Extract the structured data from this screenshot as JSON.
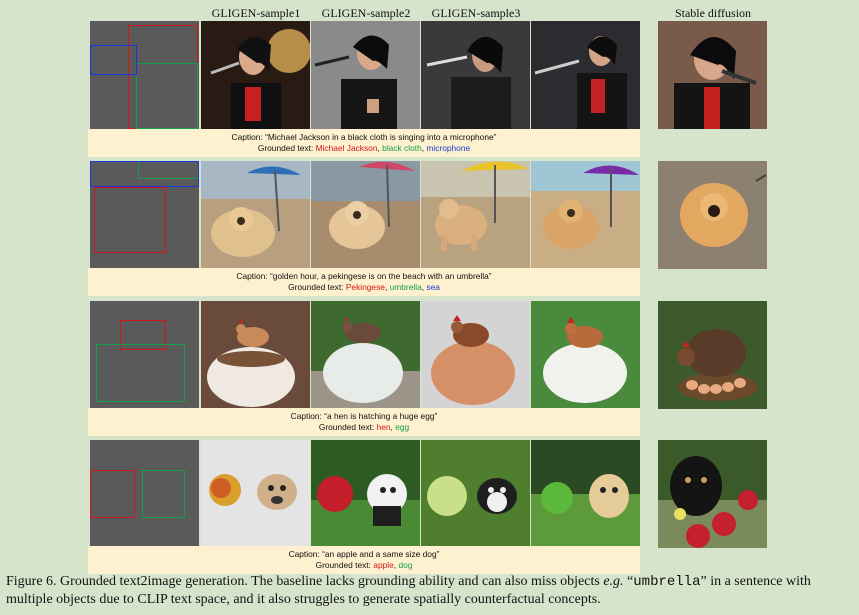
{
  "headers": {
    "sample1": "GLIGEN-sample1",
    "sample2": "GLIGEN-sample2",
    "sample3": "GLIGEN-sample3",
    "baseline": "Stable diffusion"
  },
  "rows": [
    {
      "caption": "Caption: “Michael Jackson in a black cloth is singing into a microphone”",
      "grounded_prefix": "Grounded text: ",
      "entities": [
        "Michael Jackson",
        "black cloth",
        "microphone"
      ],
      "entity_colors": [
        "#d01818",
        "#14a04a",
        "#1a38d8"
      ]
    },
    {
      "caption": "Caption: “golden hour, a pekingese is on the beach with an umbrella”",
      "grounded_prefix": "Grounded text: ",
      "entities": [
        "Pekingese",
        "umbrella",
        "sea"
      ],
      "entity_colors": [
        "#d01818",
        "#14a04a",
        "#1a38d8"
      ]
    },
    {
      "caption": "Caption: “a hen is hatching a huge egg”",
      "grounded_prefix": "Grounded text: ",
      "entities": [
        "hen",
        "egg"
      ],
      "entity_colors": [
        "#d01818",
        "#14a04a"
      ]
    },
    {
      "caption": "Caption: “an apple and a same size dog”",
      "grounded_prefix": "Grounded text: ",
      "entities": [
        "apple",
        "dog"
      ],
      "entity_colors": [
        "#d01818",
        "#14a04a"
      ]
    }
  ],
  "figure_caption": {
    "part1": "Figure 6. Grounded text2image generation. The baseline lacks grounding ability and can also miss objects ",
    "eg": "e.g.",
    "quote_open": " “",
    "code_word": "umbrella",
    "part2": "” in a sentence with multiple objects due to CLIP text space, and it also struggles to generate spatially counterfactual concepts."
  }
}
